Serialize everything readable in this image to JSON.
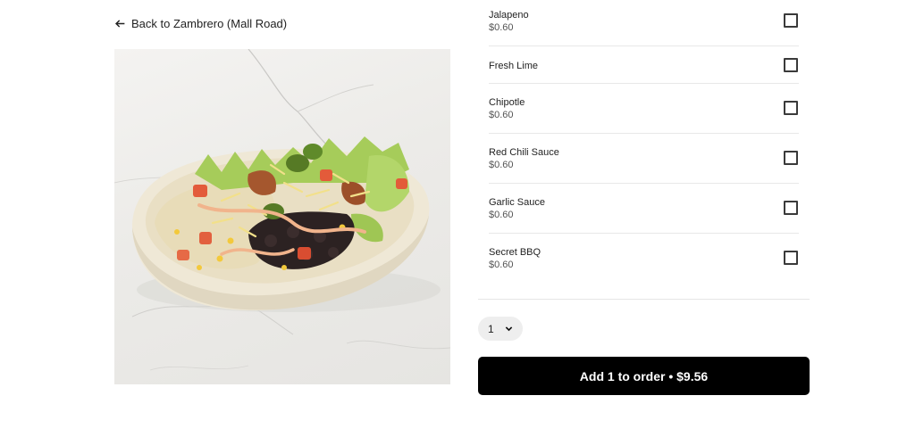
{
  "nav": {
    "back_label": "Back to Zambrero (Mall Road)"
  },
  "options": [
    {
      "name": "Jalapeno",
      "price": "$0.60"
    },
    {
      "name": "Fresh Lime",
      "price": ""
    },
    {
      "name": "Chipotle",
      "price": "$0.60"
    },
    {
      "name": "Red Chili Sauce",
      "price": "$0.60"
    },
    {
      "name": "Garlic Sauce",
      "price": "$0.60"
    },
    {
      "name": "Secret BBQ",
      "price": "$0.60"
    }
  ],
  "quantity": {
    "value": "1"
  },
  "cta": {
    "label": "Add 1 to order • $9.56"
  },
  "colors": {
    "button_bg": "#000000",
    "button_text": "#ffffff",
    "qty_bg": "#eeeeee"
  }
}
